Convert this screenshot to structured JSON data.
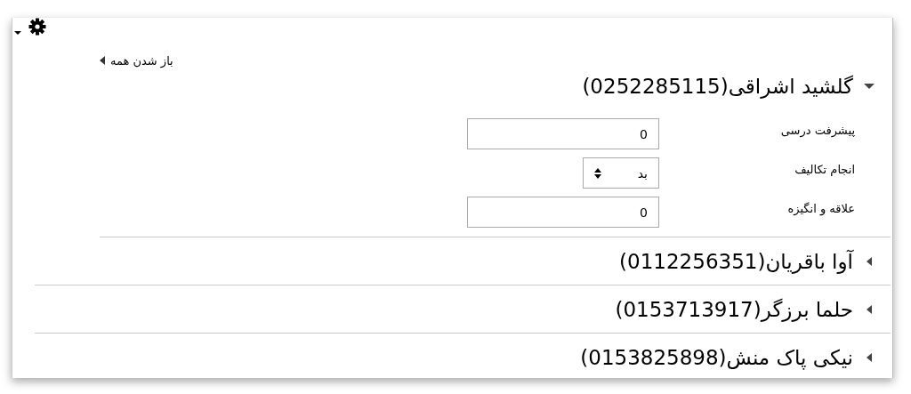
{
  "expand_all": {
    "label": "باز شدن همه"
  },
  "students": [
    {
      "name": "گلشید اشراقی(0252285115)",
      "expanded": true,
      "fields": [
        {
          "label": "پیشرفت درسی",
          "kind": "number",
          "value": "0"
        },
        {
          "label": "انجام تکالیف",
          "kind": "select",
          "value": "بد"
        },
        {
          "label": "علاقه و انگیزه",
          "kind": "number",
          "value": "0"
        }
      ]
    },
    {
      "name": "آوا باقریان(0112256351)",
      "expanded": false
    },
    {
      "name": "حلما برزگر(0153713917)",
      "expanded": false
    },
    {
      "name": "نیکی پاک منش(0153825898)",
      "expanded": false
    }
  ]
}
